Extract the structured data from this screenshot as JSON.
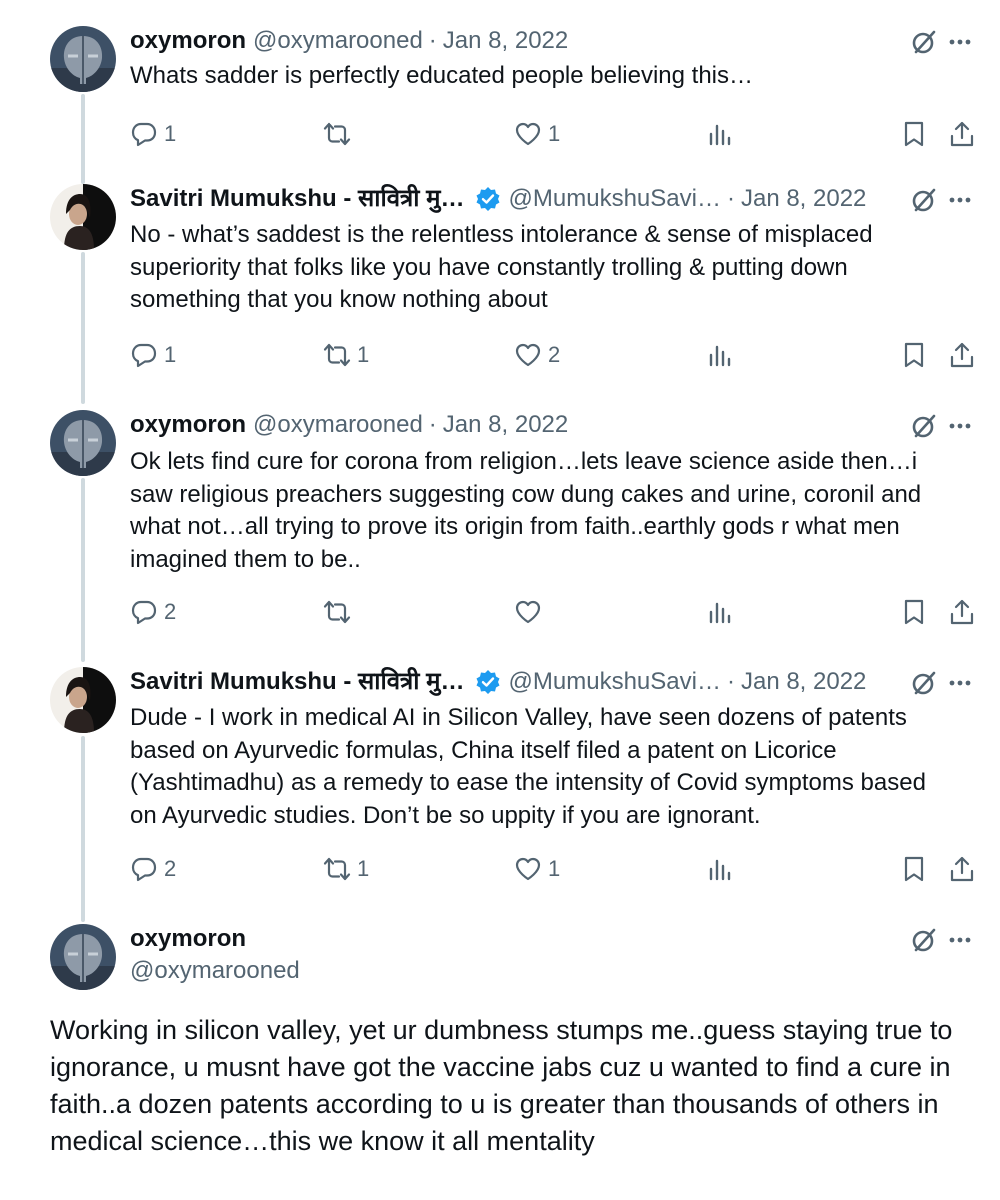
{
  "tweets": [
    {
      "name": "oxymoron",
      "handle": "@oxymarooned",
      "date": "Jan 8, 2022",
      "text": "Whats sadder is perfectly educated people believing this…",
      "replies": "1",
      "retweets": "",
      "likes": "1"
    },
    {
      "name": "Savitri Mumukshu - सावित्री मु…",
      "handle": "@MumukshuSavi…",
      "date": "Jan 8, 2022",
      "text": "No - what’s saddest is the relentless intolerance & sense of misplaced superiority that folks like you have constantly trolling & putting down something that you know nothing about",
      "replies": "1",
      "retweets": "1",
      "likes": "2"
    },
    {
      "name": "oxymoron",
      "handle": "@oxymarooned",
      "date": "Jan 8, 2022",
      "text": "Ok lets find cure for corona from religion…lets leave science aside then…i saw religious preachers suggesting cow dung cakes and urine, coronil and what not…all trying to prove its origin from faith..earthly gods r what men imagined them to be..",
      "replies": "2",
      "retweets": "",
      "likes": ""
    },
    {
      "name": "Savitri Mumukshu - सावित्री मु…",
      "handle": "@MumukshuSavi…",
      "date": "Jan 8, 2022",
      "text": "Dude - I work in medical AI in Silicon Valley, have seen dozens of patents based on Ayurvedic formulas, China itself filed a patent on Licorice (Yashtimadhu) as a remedy to ease the intensity of Covid symptoms based on Ayurvedic studies. Don’t be so uppity if you are ignorant.",
      "replies": "2",
      "retweets": "1",
      "likes": "1"
    }
  ],
  "focus": {
    "name": "oxymoron",
    "handle": "@oxymarooned",
    "text": "Working in silicon valley, yet ur dumbness stumps me..guess staying true to ignorance, u musnt have got the vaccine jabs cuz u wanted to find a cure in faith..a dozen patents according to u is greater than thousands of others in medical science…this we know it all mentality"
  },
  "separator": "·",
  "colors": {
    "text": "#0f1419",
    "secondary": "#536471",
    "verified": "#1d9bf0",
    "thread_line": "#cfd9de"
  }
}
